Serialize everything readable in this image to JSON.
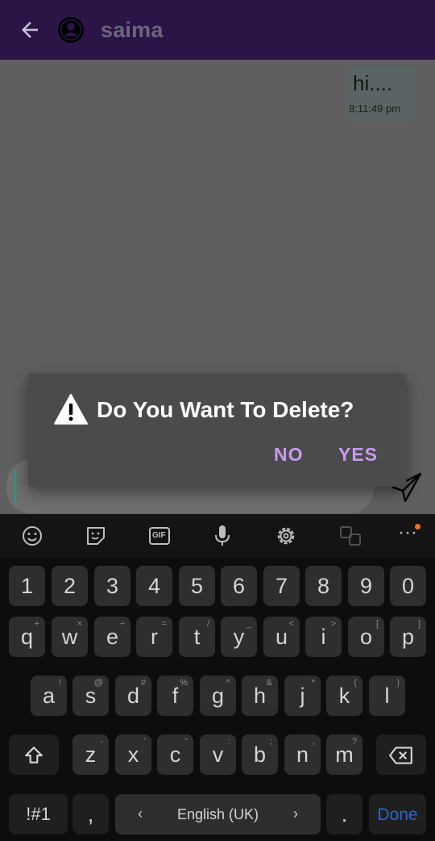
{
  "header": {
    "title": "saima",
    "back_icon": "arrow-left-icon",
    "avatar_icon": "user-avatar-icon",
    "background": "#2a1546"
  },
  "chat": {
    "messages": [
      {
        "text": "hi....",
        "time": "8:11:49 pm",
        "direction": "outgoing"
      }
    ]
  },
  "composer": {
    "placeholder": "",
    "send_icon": "paper-plane-icon"
  },
  "dialog": {
    "icon": "warning-icon",
    "message": "Do You Want To Delete?",
    "no_label": "NO",
    "yes_label": "YES",
    "accent": "#c79bf0"
  },
  "keyboard": {
    "toolbar_icons": [
      "emoji-icon",
      "sticker-icon",
      "gif-icon",
      "microphone-icon",
      "settings-icon",
      "translate-icon",
      "more-icon"
    ],
    "gif_label": "GIF",
    "more_label": "···",
    "numbers": [
      "1",
      "2",
      "3",
      "4",
      "5",
      "6",
      "7",
      "8",
      "9",
      "0"
    ],
    "row1": [
      {
        "key": "q",
        "sub": "+"
      },
      {
        "key": "w",
        "sub": "×"
      },
      {
        "key": "e",
        "sub": "÷"
      },
      {
        "key": "r",
        "sub": "="
      },
      {
        "key": "t",
        "sub": "/"
      },
      {
        "key": "y",
        "sub": "_"
      },
      {
        "key": "u",
        "sub": "<"
      },
      {
        "key": "i",
        "sub": ">"
      },
      {
        "key": "o",
        "sub": "["
      },
      {
        "key": "p",
        "sub": "]"
      }
    ],
    "row2": [
      {
        "key": "a",
        "sub": "!"
      },
      {
        "key": "s",
        "sub": "@"
      },
      {
        "key": "d",
        "sub": "#"
      },
      {
        "key": "f",
        "sub": "%"
      },
      {
        "key": "g",
        "sub": "^"
      },
      {
        "key": "h",
        "sub": "&"
      },
      {
        "key": "j",
        "sub": "*"
      },
      {
        "key": "k",
        "sub": "("
      },
      {
        "key": "l",
        "sub": ")"
      }
    ],
    "row3": [
      {
        "key": "z",
        "sub": "-"
      },
      {
        "key": "x",
        "sub": "'"
      },
      {
        "key": "c",
        "sub": "\""
      },
      {
        "key": "v",
        "sub": ":"
      },
      {
        "key": "b",
        "sub": ";"
      },
      {
        "key": "n",
        "sub": ","
      },
      {
        "key": "m",
        "sub": "?"
      }
    ],
    "shift_icon": "shift-icon",
    "backspace_icon": "backspace-icon",
    "symbols_label": "!#1",
    "comma_label": ",",
    "language_label": "English (UK)",
    "left_arrow": "‹",
    "right_arrow": "›",
    "period_label": ".",
    "done_label": "Done"
  }
}
